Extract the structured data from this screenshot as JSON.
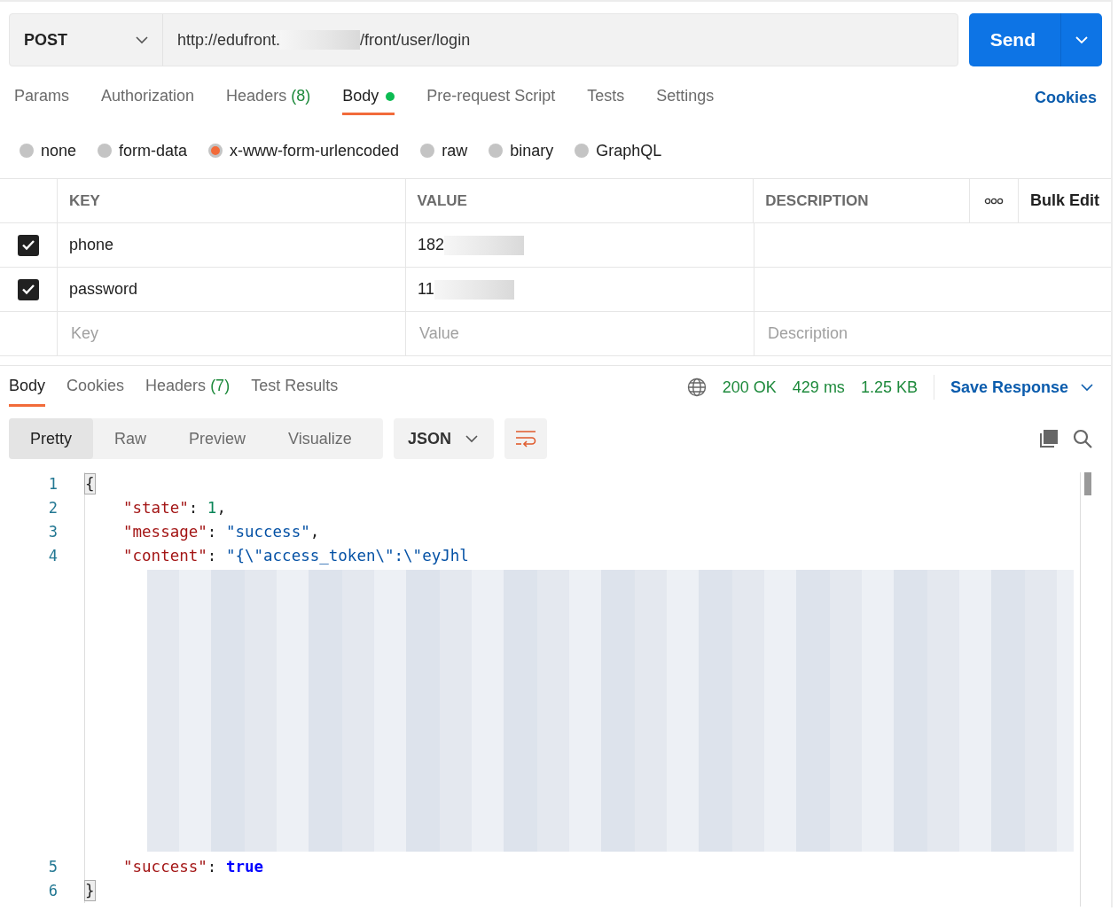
{
  "request": {
    "method": "POST",
    "url_start": "http://edufront.",
    "url_end": "/front/user/login",
    "send": "Send"
  },
  "tabs": [
    {
      "label": "Params",
      "dot": false,
      "selected": false
    },
    {
      "label": "Authorization",
      "dot": false,
      "selected": false
    },
    {
      "label": "Headers",
      "count": "(8)",
      "dot": false,
      "selected": false
    },
    {
      "label": "Body",
      "dot": true,
      "selected": true
    },
    {
      "label": "Pre-request Script",
      "dot": false,
      "selected": false
    },
    {
      "label": "Tests",
      "dot": false,
      "selected": false
    },
    {
      "label": "Settings",
      "dot": false,
      "selected": false
    }
  ],
  "cookies_link": "Cookies",
  "body_types": [
    {
      "label": "none",
      "selected": false
    },
    {
      "label": "form-data",
      "selected": false
    },
    {
      "label": "x-www-form-urlencoded",
      "selected": true
    },
    {
      "label": "raw",
      "selected": false
    },
    {
      "label": "binary",
      "selected": false
    },
    {
      "label": "GraphQL",
      "selected": false
    }
  ],
  "params_table": {
    "columns": [
      "KEY",
      "VALUE",
      "DESCRIPTION"
    ],
    "bulk_edit": "Bulk Edit",
    "rows": [
      {
        "checked": true,
        "key": "phone",
        "value": "182"
      },
      {
        "checked": true,
        "key": "password",
        "value": "11"
      }
    ],
    "new_row": {
      "key": {
        "placeholder": "Key"
      },
      "value": {
        "placeholder": "Value"
      },
      "description": {
        "placeholder": "Description"
      }
    }
  },
  "response": {
    "tabs": [
      {
        "label": "Body",
        "selected": true
      },
      {
        "label": "Cookies",
        "selected": false
      },
      {
        "label": "Headers",
        "count": "(7)",
        "selected": false
      },
      {
        "label": "Test Results",
        "selected": false
      }
    ],
    "status": "200 OK",
    "time": "429 ms",
    "size": "1.25 KB",
    "save": "Save Response",
    "view_modes": [
      {
        "label": "Pretty",
        "selected": true
      },
      {
        "label": "Raw",
        "selected": false
      },
      {
        "label": "Preview",
        "selected": false
      },
      {
        "label": "Visualize",
        "selected": false
      }
    ],
    "format": "JSON",
    "lines": [
      {
        "kind": "brace",
        "number": "1",
        "highlighted": true,
        "tokens": [
          {
            "kind": "punct",
            "text": "{"
          }
        ]
      },
      {
        "kind": "member",
        "number": "2",
        "tokens": [
          {
            "kind": "key",
            "text": "\"state\""
          },
          {
            "kind": "punct",
            "text": ": "
          },
          {
            "kind": "number",
            "text": "1"
          },
          {
            "kind": "punct",
            "text": ","
          }
        ]
      },
      {
        "kind": "member",
        "number": "3",
        "tokens": [
          {
            "kind": "key",
            "text": "\"message\""
          },
          {
            "kind": "punct",
            "text": ": "
          },
          {
            "kind": "string",
            "text": "\"success\""
          },
          {
            "kind": "punct",
            "text": ","
          }
        ]
      },
      {
        "kind": "member",
        "number": "4",
        "tokens": [
          {
            "kind": "key",
            "text": "\"content\""
          },
          {
            "kind": "punct",
            "text": ": "
          },
          {
            "kind": "string",
            "text": "\"{\\\"access_token\\\":\\\"eyJhl"
          }
        ]
      },
      {
        "kind": "redacted"
      },
      {
        "kind": "member",
        "number": "5",
        "tokens": [
          {
            "kind": "key",
            "text": "\"success\""
          },
          {
            "kind": "punct",
            "text": ": "
          },
          {
            "kind": "boolean",
            "text": "true"
          }
        ]
      },
      {
        "kind": "brace",
        "number": "6",
        "highlighted": true,
        "tokens": [
          {
            "kind": "punct",
            "text": "}"
          }
        ]
      }
    ]
  }
}
